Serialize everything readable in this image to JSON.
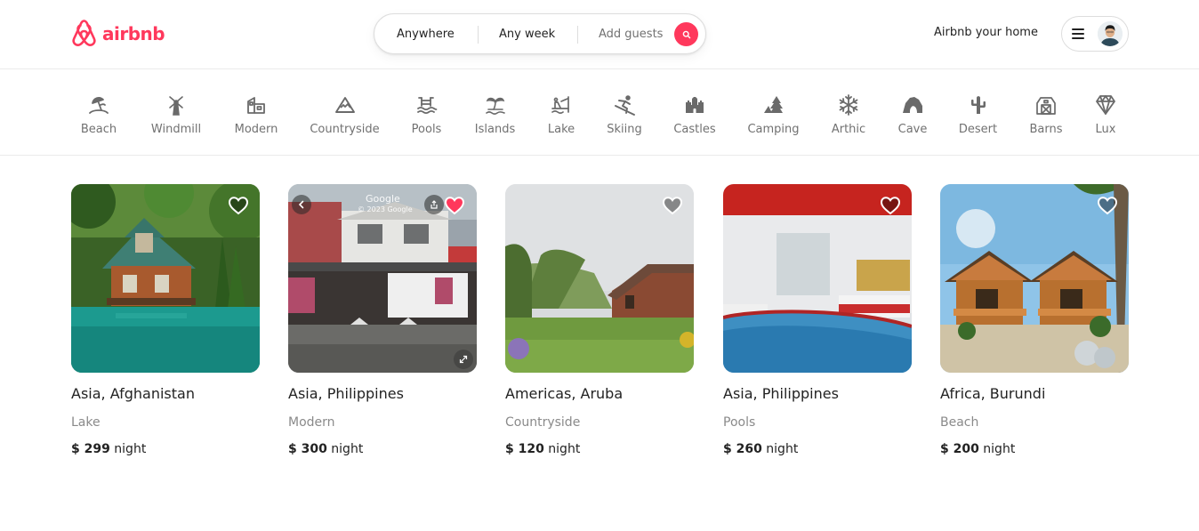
{
  "brand": {
    "name": "airbnb",
    "color": "#ff385c"
  },
  "search": {
    "location": "Anywhere",
    "dates": "Any week",
    "guests": "Add guests",
    "button_icon": "search-icon"
  },
  "header": {
    "host_link": "Airbnb your home",
    "menu_icon": "hamburger-icon",
    "avatar_icon": "user-avatar"
  },
  "categories": [
    {
      "label": "Beach",
      "icon": "beach-umbrella-icon"
    },
    {
      "label": "Windmill",
      "icon": "windmill-icon"
    },
    {
      "label": "Modern",
      "icon": "modern-house-icon"
    },
    {
      "label": "Countryside",
      "icon": "mountain-icon"
    },
    {
      "label": "Pools",
      "icon": "pool-icon"
    },
    {
      "label": "Islands",
      "icon": "island-icon"
    },
    {
      "label": "Lake",
      "icon": "lake-icon"
    },
    {
      "label": "Skiing",
      "icon": "skiing-icon"
    },
    {
      "label": "Castles",
      "icon": "castle-icon"
    },
    {
      "label": "Camping",
      "icon": "camping-icon"
    },
    {
      "label": "Arthic",
      "icon": "snowflake-icon"
    },
    {
      "label": "Cave",
      "icon": "cave-icon"
    },
    {
      "label": "Desert",
      "icon": "cactus-icon"
    },
    {
      "label": "Barns",
      "icon": "barn-icon"
    },
    {
      "label": "Lux",
      "icon": "diamond-icon"
    }
  ],
  "listings": [
    {
      "title": "Asia, Afghanistan",
      "category": "Lake",
      "price": "$ 299",
      "unit": "night",
      "favorited": false,
      "photo": "cabin by turquoise lake"
    },
    {
      "title": "Asia, Philippines",
      "category": "Modern",
      "price": "$ 300",
      "unit": "night",
      "favorited": true,
      "photo": "street view of white house",
      "photo_overlay": {
        "brand": "Google",
        "copyright": "© 2023 Google"
      }
    },
    {
      "title": "Americas, Aruba",
      "category": "Countryside",
      "price": "$ 120",
      "unit": "night",
      "favorited": false,
      "photo": "countryside brick house"
    },
    {
      "title": "Asia, Philippines",
      "category": "Pools",
      "price": "$ 260",
      "unit": "night",
      "favorited": false,
      "photo": "indoor pool bedroom"
    },
    {
      "title": "Africa, Burundi",
      "category": "Beach",
      "price": "$ 200",
      "unit": "night",
      "favorited": false,
      "photo": "beach bungalows"
    }
  ]
}
